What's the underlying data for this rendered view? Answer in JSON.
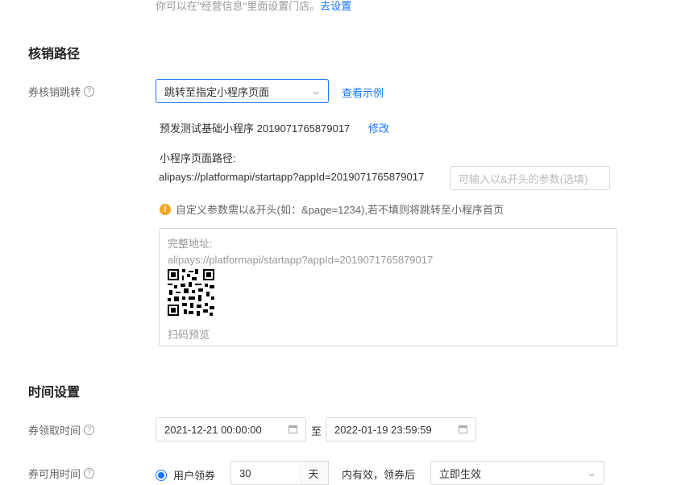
{
  "top_hint": {
    "text": "你可以在\"经营信息\"里面设置门店。",
    "link": "去设置"
  },
  "redeem_section": {
    "title": "核销路径",
    "jump_label": "券核销跳转",
    "jump_select": "跳转至指定小程序页面",
    "view_example": "查看示例",
    "app_info": "预发测试基础小程序 2019071765879017",
    "modify": "修改",
    "path_label": "小程序页面路径:",
    "path_value": "alipays://platformapi/startapp?appId=2019071765879017",
    "param_placeholder": "可输入以&开头的参数(选填)",
    "warning": "自定义参数需以&开头(如：&page=1234),若不填则将跳转至小程序首页",
    "preview": {
      "full_address_label": "完整地址:",
      "full_address_value": "alipays://platformapi/startapp?appId=2019071765879017",
      "scan_label": "扫码预览"
    }
  },
  "time_section": {
    "title": "时间设置",
    "receive_label": "券领取时间",
    "start_date": "2021-12-21 00:00:00",
    "to": "至",
    "end_date": "2022-01-19 23:59:59",
    "usable_label": "券可用时间",
    "radio_label": "用户领券",
    "days_value": "30",
    "days_unit": "天",
    "valid_text": "内有效，领券后",
    "effective_select": "立即生效"
  },
  "colors": {
    "accent": "#1677ff",
    "warning": "#f5a623"
  }
}
